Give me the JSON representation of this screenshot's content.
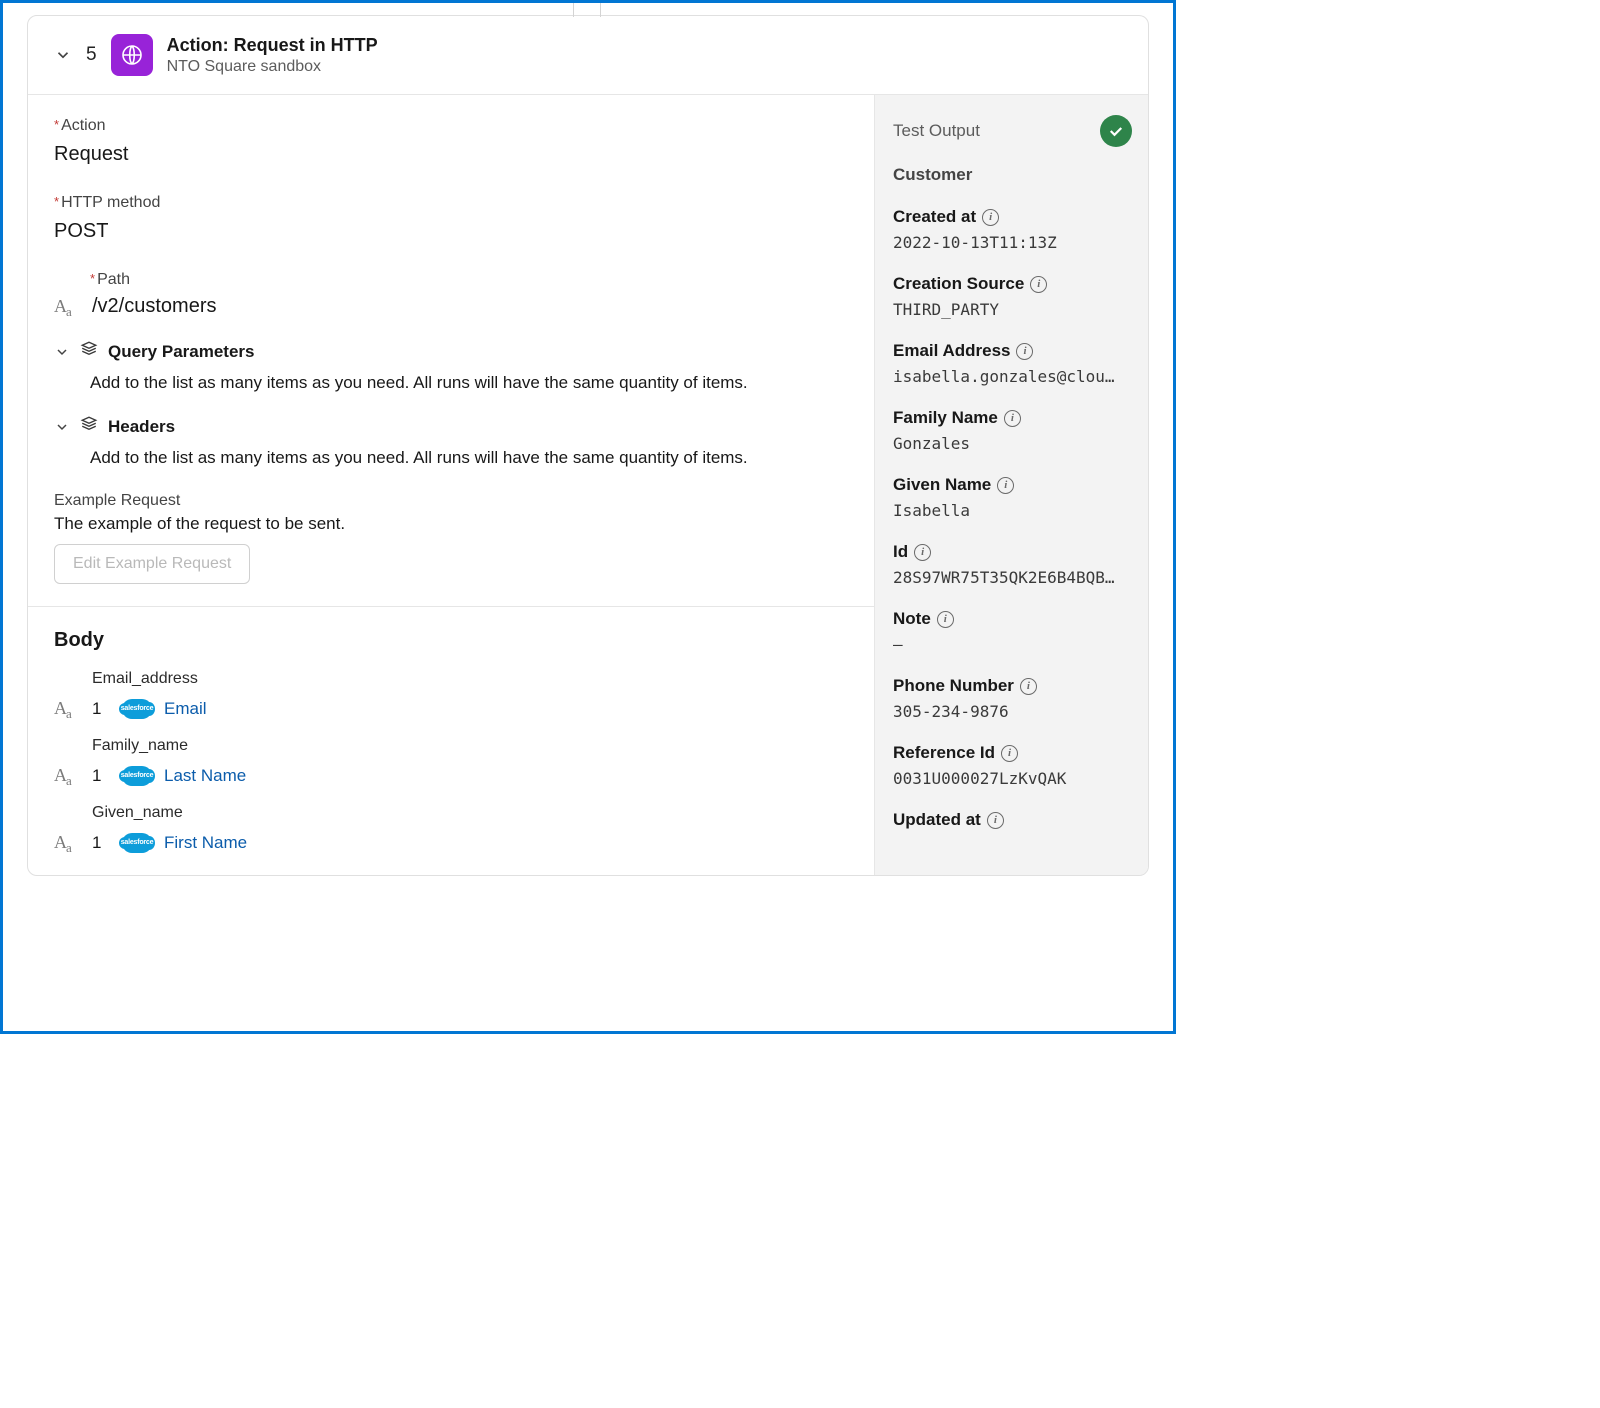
{
  "header": {
    "step": "5",
    "title": "Action: Request in HTTP",
    "subtitle": "NTO Square sandbox"
  },
  "form": {
    "action_label": "Action",
    "action_value": "Request",
    "method_label": "HTTP method",
    "method_value": "POST",
    "path_label": "Path",
    "path_value": "/v2/customers",
    "qp_title": "Query Parameters",
    "qp_desc": "Add to the list as many items as you need. All runs will have the same quantity of items.",
    "hd_title": "Headers",
    "hd_desc": "Add to the list as many items as you need. All runs will have the same quantity of items.",
    "ex_label": "Example Request",
    "ex_desc": "The example of the request to be sent.",
    "ex_btn": "Edit Example Request"
  },
  "body": {
    "title": "Body",
    "fields": [
      {
        "label": "Email_address",
        "ord": "1",
        "pill": "Email"
      },
      {
        "label": "Family_name",
        "ord": "1",
        "pill": "Last Name"
      },
      {
        "label": "Given_name",
        "ord": "1",
        "pill": "First Name"
      }
    ]
  },
  "output": {
    "title": "Test Output",
    "section": "Customer",
    "fields": [
      {
        "label": "Created at",
        "value": "2022-10-13T11:13Z"
      },
      {
        "label": "Creation Source",
        "value": "THIRD_PARTY"
      },
      {
        "label": "Email Address",
        "value": "isabella.gonzales@clou…"
      },
      {
        "label": "Family Name",
        "value": "Gonzales"
      },
      {
        "label": "Given Name",
        "value": "Isabella"
      },
      {
        "label": "Id",
        "value": "28S97WR75T35QK2E6B4BQB…"
      },
      {
        "label": "Note",
        "value": "–"
      },
      {
        "label": "Phone Number",
        "value": "305-234-9876"
      },
      {
        "label": "Reference Id",
        "value": "0031U000027LzKvQAK"
      },
      {
        "label": "Updated at",
        "value": ""
      }
    ]
  }
}
